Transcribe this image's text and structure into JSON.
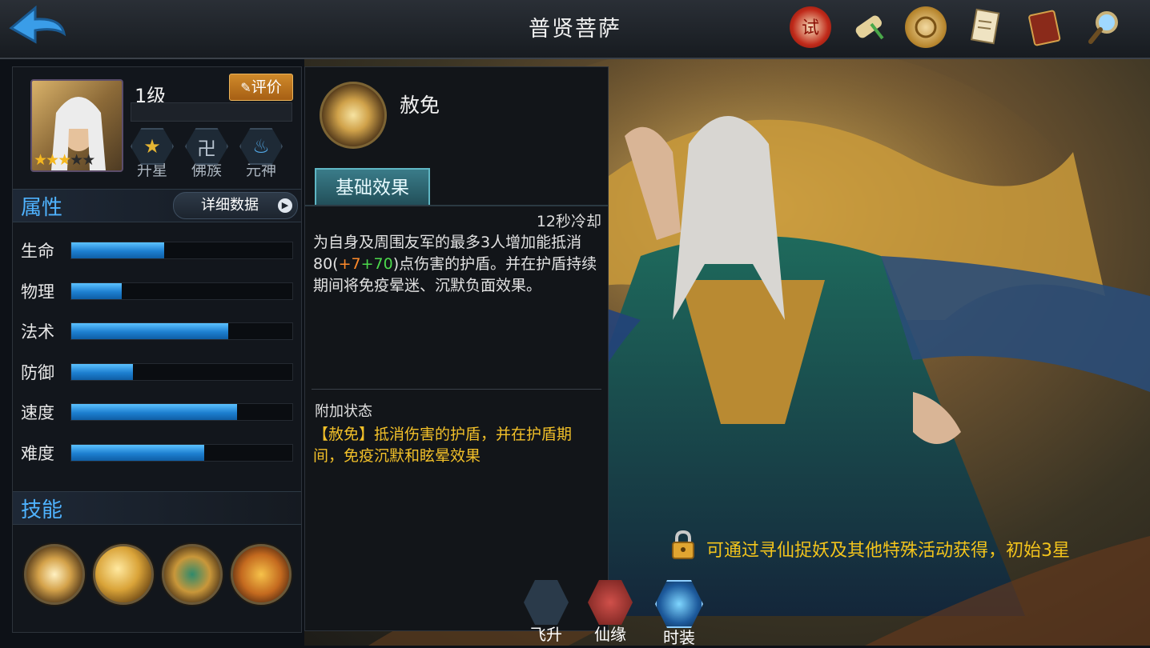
{
  "header": {
    "title": "普贤菩萨",
    "icons": [
      "trial-seal-icon",
      "scroll-icon",
      "coin-icon",
      "document-icon",
      "book-icon",
      "magnifier-icon"
    ]
  },
  "hero": {
    "level": "1级",
    "rate_label": "评价",
    "stars_total": 5,
    "stars_filled": 3,
    "tags": [
      {
        "label": "升星",
        "icon": "star-cluster-icon"
      },
      {
        "label": "佛族",
        "icon": "swastika-icon"
      },
      {
        "label": "元神",
        "icon": "spirit-flame-icon"
      }
    ]
  },
  "attributes": {
    "title": "属性",
    "detail_button": "详细数据",
    "stats": [
      {
        "name": "生命",
        "fraction": 0.42
      },
      {
        "name": "物理",
        "fraction": 0.23
      },
      {
        "name": "法术",
        "fraction": 0.71
      },
      {
        "name": "防御",
        "fraction": 0.28
      },
      {
        "name": "速度",
        "fraction": 0.75
      },
      {
        "name": "难度",
        "fraction": 0.6
      }
    ]
  },
  "skills": {
    "title": "技能",
    "icons": [
      "skill-pardon-icon",
      "skill-2-icon",
      "skill-3-icon",
      "skill-4-icon"
    ]
  },
  "skill_detail": {
    "name": "赦免",
    "tab": "基础效果",
    "cooldown": "12秒冷却",
    "desc_part1": "为自身及周围友军的最多3人增加能抵消80(",
    "desc_orange": "+7",
    "desc_green": "+70",
    "desc_part2": ")点伤害的护盾。并在护盾持续期间将免疫晕迷、沉默负面效果。",
    "extra_title": "附加状态",
    "extra_text": "【赦免】抵消伤害的护盾，并在护盾期间，免疫沉默和眩晕效果"
  },
  "bottom_nav": [
    {
      "label": "飞升",
      "icon": "ascend-icon"
    },
    {
      "label": "仙缘",
      "icon": "fate-icon"
    },
    {
      "label": "时装",
      "icon": "costume-icon"
    }
  ],
  "unlock_text": "可通过寻仙捉妖及其他特殊活动获得，初始3星",
  "colors": {
    "accent_blue": "#4fb3ff",
    "bar_blue": "#1d7fd0",
    "gold": "#f3c41c",
    "orange": "#ff8a2a",
    "green": "#4cd94c"
  }
}
